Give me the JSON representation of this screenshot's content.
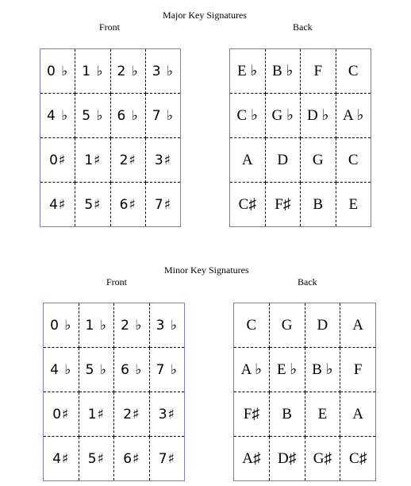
{
  "sections": [
    {
      "title": "Major Key Signatures",
      "front_label": "Front",
      "back_label": "Back",
      "front": [
        [
          "0 ♭",
          "1 ♭",
          "2 ♭",
          "3 ♭"
        ],
        [
          "4 ♭",
          "5 ♭",
          "6 ♭",
          "7 ♭"
        ],
        [
          "0♯",
          "1♯",
          "2♯",
          "3♯"
        ],
        [
          "4♯",
          "5♯",
          "6♯",
          "7♯"
        ]
      ],
      "back": [
        [
          "E ♭",
          "B ♭",
          "F",
          "C"
        ],
        [
          "C ♭",
          "G ♭",
          "D ♭",
          "A ♭"
        ],
        [
          "A",
          "D",
          "G",
          "C"
        ],
        [
          "C♯",
          "F♯",
          "B",
          "E"
        ]
      ]
    },
    {
      "title": "Minor Key Signatures",
      "front_label": "Front",
      "back_label": "Back",
      "front": [
        [
          "0 ♭",
          "1 ♭",
          "2 ♭",
          "3 ♭"
        ],
        [
          "4 ♭",
          "5 ♭",
          "6 ♭",
          "7 ♭"
        ],
        [
          "0♯",
          "1♯",
          "2♯",
          "3♯"
        ],
        [
          "4♯",
          "5♯",
          "6♯",
          "7♯"
        ]
      ],
      "back": [
        [
          "C",
          "G",
          "D",
          "A"
        ],
        [
          "A ♭",
          "E ♭",
          "B ♭",
          "F"
        ],
        [
          "F♯",
          "B",
          "E",
          "A"
        ],
        [
          "A♯",
          "D♯",
          "G♯",
          "C♯"
        ]
      ]
    }
  ]
}
